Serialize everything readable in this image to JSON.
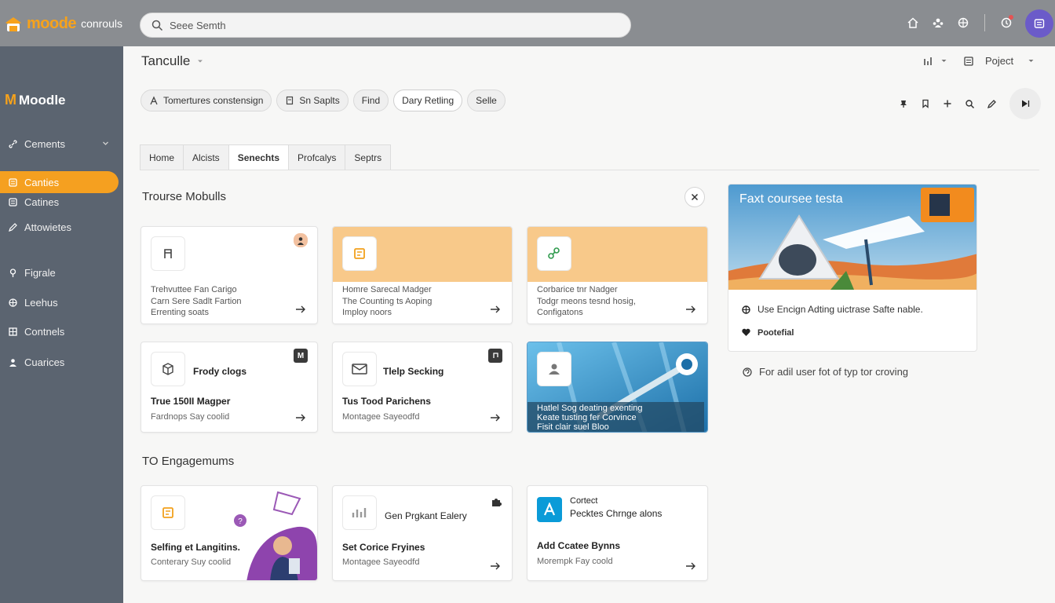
{
  "brand": {
    "name": "moode",
    "sub": "conrouls",
    "color": "#f7a21b"
  },
  "search": {
    "placeholder": "Seee Semth"
  },
  "topbar": {
    "icons": [
      "home-icon",
      "users-icon",
      "globe-icon",
      "notification-icon"
    ],
    "avatar_icon": "profile-icon"
  },
  "sidebar": {
    "logo_text": "Moodle",
    "items": [
      {
        "label": "Cements",
        "icon": "link-icon",
        "expandable": true
      },
      {
        "label": "Canties",
        "icon": "list-icon",
        "active": true
      },
      {
        "label": "Catines",
        "icon": "list-icon"
      },
      {
        "label": "Attowietes",
        "icon": "pencil-icon"
      },
      {
        "label": "Figrale",
        "icon": "pin-icon"
      },
      {
        "label": "Leehus",
        "icon": "globe-icon"
      },
      {
        "label": "Contnels",
        "icon": "grid-icon"
      },
      {
        "label": "Cuarices",
        "icon": "person-icon"
      }
    ]
  },
  "header": {
    "breadcrumb": "Tanculle",
    "project_label": "Poject"
  },
  "chips": [
    {
      "label": "Tomertures constensign",
      "icon": "person-icon"
    },
    {
      "label": "Sn Saplts",
      "icon": "document-icon"
    },
    {
      "label": "Find"
    },
    {
      "label": "Dary Retling",
      "selected": true
    },
    {
      "label": "Selle"
    }
  ],
  "tabs": [
    {
      "label": "Home"
    },
    {
      "label": "Alcists"
    },
    {
      "label": "Senechts",
      "active": true
    },
    {
      "label": "Profcalys"
    },
    {
      "label": "Septrs"
    }
  ],
  "section1": {
    "title": "Trourse Mobulls"
  },
  "section2": {
    "title": "TO Engagemums"
  },
  "cards": [
    {
      "lines": [
        "Trehvuttee Fan Carigo",
        "Carn Sere Sadlt Fartion",
        "Errenting soats"
      ],
      "icon": "music-icon"
    },
    {
      "lines": [
        "Homre Sarecal Madger",
        "The Counting ts Aoping",
        "Imploy noors"
      ],
      "icon": "document-icon"
    },
    {
      "lines": [
        "Corbarice tnr Nadger",
        "Todgr meons tesnd hosig,",
        "Configatons"
      ],
      "icon": "share-icon"
    },
    {
      "title": "Frody clogs",
      "t1": "True 150II Magper",
      "t2": "Fardnops Say coolid",
      "icon": "box-icon",
      "badge": "M"
    },
    {
      "title": "Tlelp Secking",
      "t1": "Tus Tood Parichens",
      "t2": "Montagee Sayeodfd",
      "icon": "mail-icon"
    },
    {
      "lines": [
        "Hatlel Sog deating exenting",
        "Keate tusting fer Corvince",
        "Fisit clair suel Bloo"
      ],
      "icon": "person-icon"
    },
    {
      "t1": "Selfing et Langitins.",
      "t2": "Conterary Suy coolid",
      "icon": "document-icon"
    },
    {
      "title": "Gen Prgkant Ealery",
      "t1": "Set Corice Fryines",
      "t2": "Montagee Sayeodfd",
      "icon": "chart-icon"
    },
    {
      "title": "Cortect",
      "subtitle": "Pecktes Chrnge alons",
      "t1": "Add Ccatee Bynns",
      "t2": "Morempk Fay coold",
      "icon": "a-icon"
    }
  ],
  "promo": {
    "title": "Faxt coursee testa",
    "rows": [
      {
        "text": "Use Encign Adting uictrase Safte nable.",
        "icon": "globe-icon"
      },
      {
        "text": "Pootefial",
        "icon": "heart-icon"
      }
    ]
  },
  "footnote": {
    "text": "For adil user fot of typ tor croving",
    "icon": "support-icon"
  }
}
